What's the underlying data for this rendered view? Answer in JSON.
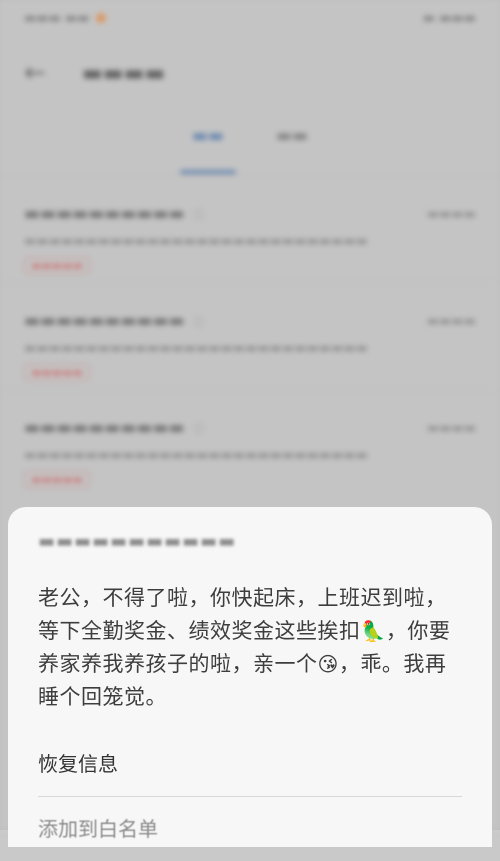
{
  "status_bar": {
    "carrier": "",
    "right": ""
  },
  "app_bar": {
    "title": ""
  },
  "tabs": [
    {
      "label": ""
    },
    {
      "label": ""
    }
  ],
  "messages": [
    {
      "number": "",
      "time": "",
      "preview": "",
      "tag": ""
    },
    {
      "number": "",
      "time": "",
      "preview": "",
      "tag": ""
    },
    {
      "number": "",
      "time": "",
      "preview": "",
      "tag": ""
    }
  ],
  "sheet": {
    "sender": "",
    "body_part1": "老公，不得了啦，你快起床，上班迟到啦，等下全勤奖金、绩效奖金这些挨扣",
    "emoji1": "🦜",
    "body_part2": "，你要养家养我养孩子的啦，亲一个",
    "emoji2": "😘",
    "body_part3": "，乖。我再睡个回笼觉。",
    "action_restore": "恢复信息",
    "action_whitelist": "添加到白名单"
  }
}
